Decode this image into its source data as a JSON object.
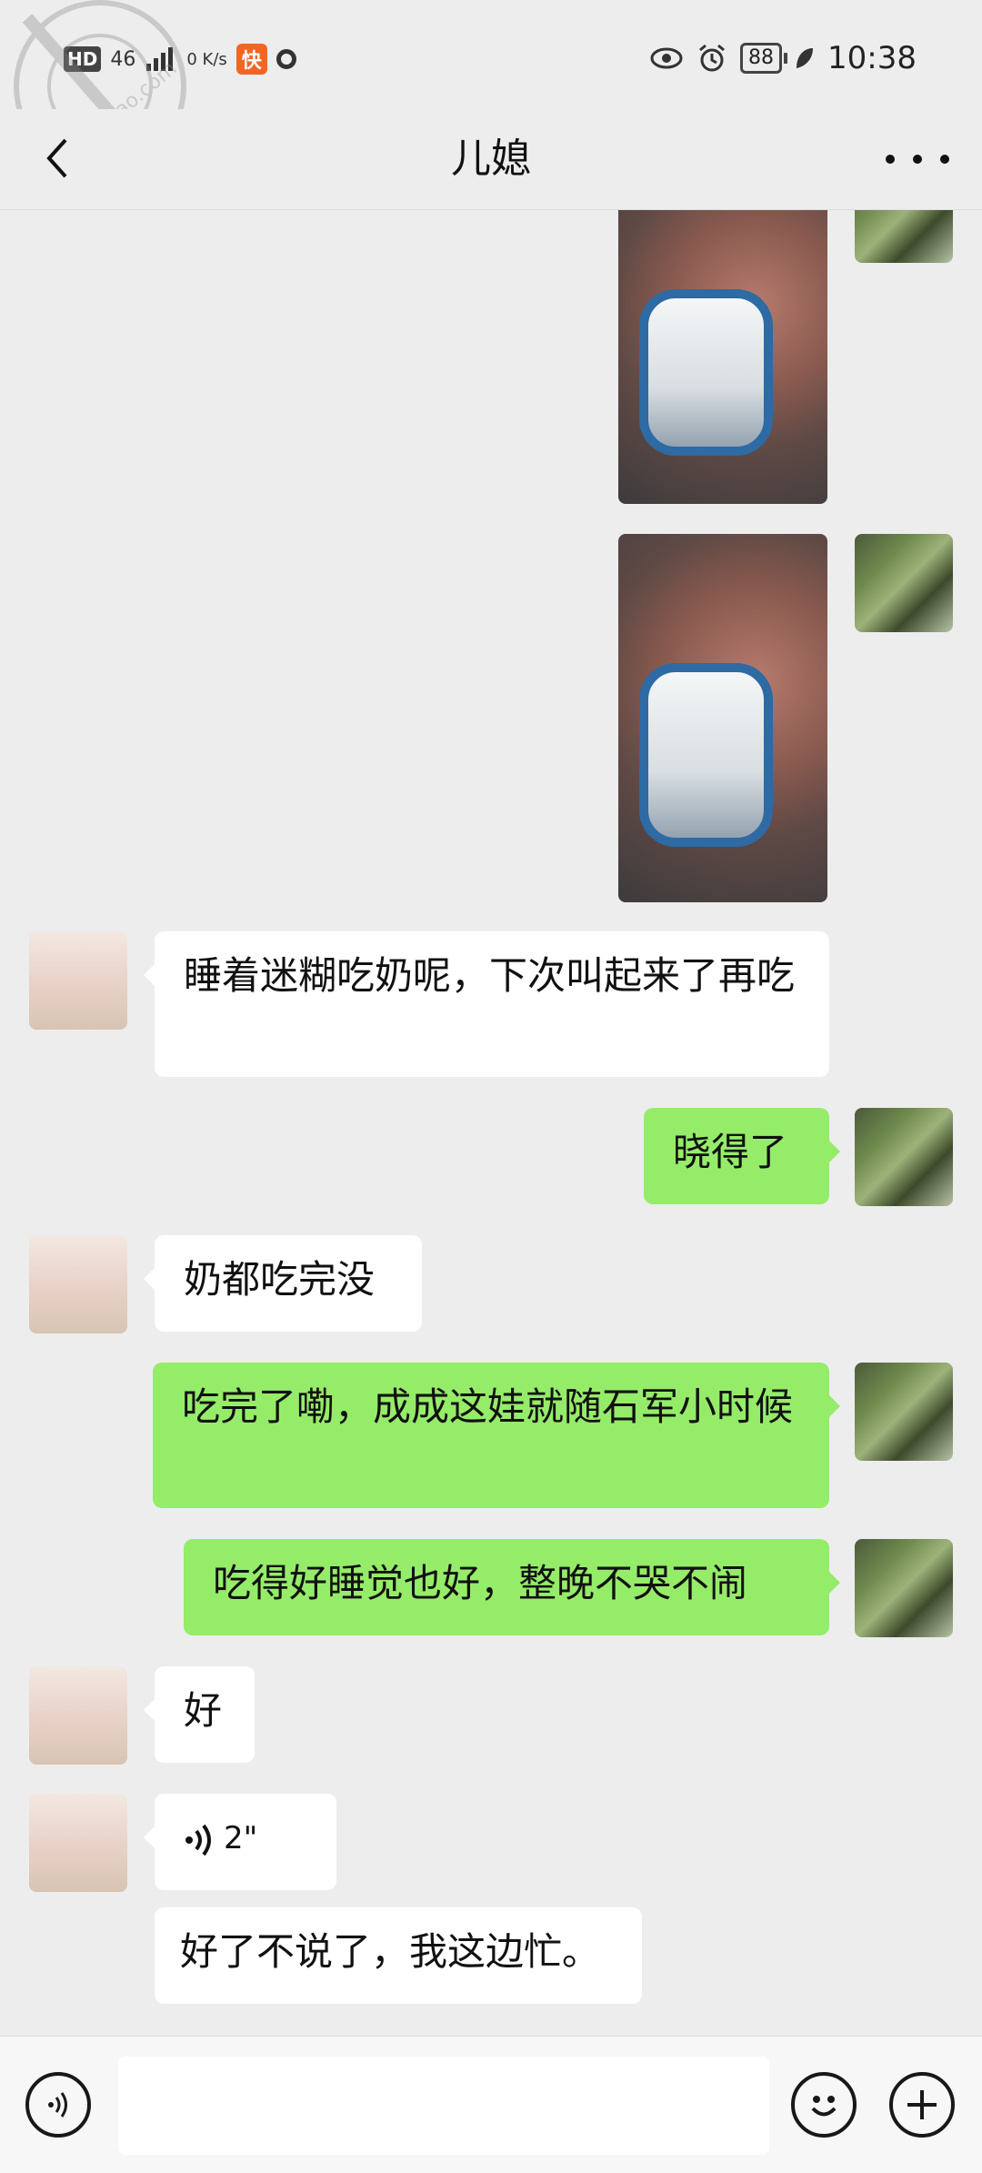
{
  "status_bar": {
    "network_hd": "HD",
    "network_type": "46",
    "data_speed": "0 K/s",
    "battery": "88",
    "time": "10:38",
    "icons": [
      "hd-icon",
      "signal-icon",
      "app-notification-icon",
      "circle-icon",
      "eye-icon",
      "alarm-icon",
      "battery-icon",
      "leaf-icon"
    ]
  },
  "watermark": {
    "text": "haijiao.com"
  },
  "header": {
    "title": "儿媳"
  },
  "messages": [
    {
      "side": "right",
      "type": "image",
      "text": ""
    },
    {
      "side": "right",
      "type": "image",
      "text": ""
    },
    {
      "side": "left",
      "type": "text",
      "text": "睡着迷糊吃奶呢，下次叫起来了再吃"
    },
    {
      "side": "right",
      "type": "text",
      "text": "晓得了"
    },
    {
      "side": "left",
      "type": "text",
      "text": "奶都吃完没"
    },
    {
      "side": "right",
      "type": "text",
      "text": "吃完了嘞，成成这娃就随石军小时候"
    },
    {
      "side": "right",
      "type": "text",
      "text": "吃得好睡觉也好，整晚不哭不闹"
    },
    {
      "side": "left",
      "type": "text",
      "text": "好"
    },
    {
      "side": "left",
      "type": "voice",
      "text": "2\""
    },
    {
      "side": "left",
      "type": "transcript",
      "text": "好了不说了，我这边忙。"
    }
  ],
  "input_bar": {
    "placeholder": "",
    "value": ""
  },
  "colors": {
    "bg": "#ededed",
    "green_bubble": "#95ec69",
    "white_bubble": "#ffffff"
  }
}
